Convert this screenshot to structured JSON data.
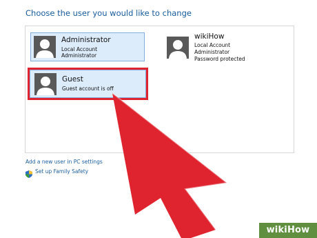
{
  "heading": "Choose the user you would like to change",
  "users": [
    {
      "name": "Administrator",
      "line1": "Local Account",
      "line2": "Administrator"
    },
    {
      "name": "wikiHow",
      "line1": "Local Account",
      "line2": "Administrator",
      "line3": "Password protected"
    },
    {
      "name": "Guest",
      "line1": "Guest account is off"
    }
  ],
  "links": {
    "add_user": "Add a new user in PC settings",
    "family_safety": "Set up Family Safety"
  },
  "watermark": {
    "wiki": "wiki",
    "how": "How"
  },
  "colors": {
    "accent": "#1a5d9e",
    "selection_border": "#e0242f",
    "arrow": "#e0242f",
    "tile_bg": "#dcecfb"
  }
}
